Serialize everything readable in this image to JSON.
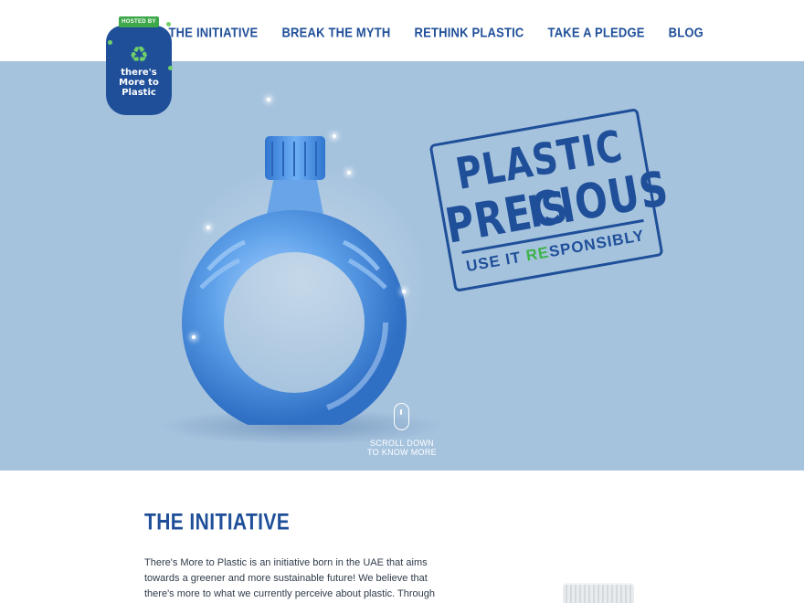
{
  "logo": {
    "badge": "HOSTED BY",
    "text_lines": [
      "there's",
      "More to",
      "Plastic"
    ]
  },
  "nav": {
    "items": [
      "THE INITIATIVE",
      "BREAK THE MYTH",
      "RETHINK PLASTIC",
      "TAKE A PLEDGE",
      "BLOG"
    ]
  },
  "hero": {
    "stamp": {
      "line1": "PLASTIC IS",
      "line2": "PRECIOUS",
      "sub_prefix": "USE IT ",
      "sub_accent": "RE",
      "sub_suffix": "SPONSIBLY"
    },
    "scroll": {
      "line1": "SCROLL DOWN",
      "line2": "TO KNOW MORE"
    }
  },
  "initiative": {
    "title": "THE INITIATIVE",
    "body": "There's More to Plastic is an initiative born in the UAE that aims towards a greener and more sustainable future! We believe that there's more to what we currently perceive about plastic. Through"
  },
  "colors": {
    "brand_blue": "#1f4f99",
    "hero_bg": "#a6c3de",
    "accent_green": "#3db34a",
    "ring_blue": "#4f93e0"
  },
  "icons": [
    "recycle-icon",
    "mouse-scroll-icon"
  ]
}
